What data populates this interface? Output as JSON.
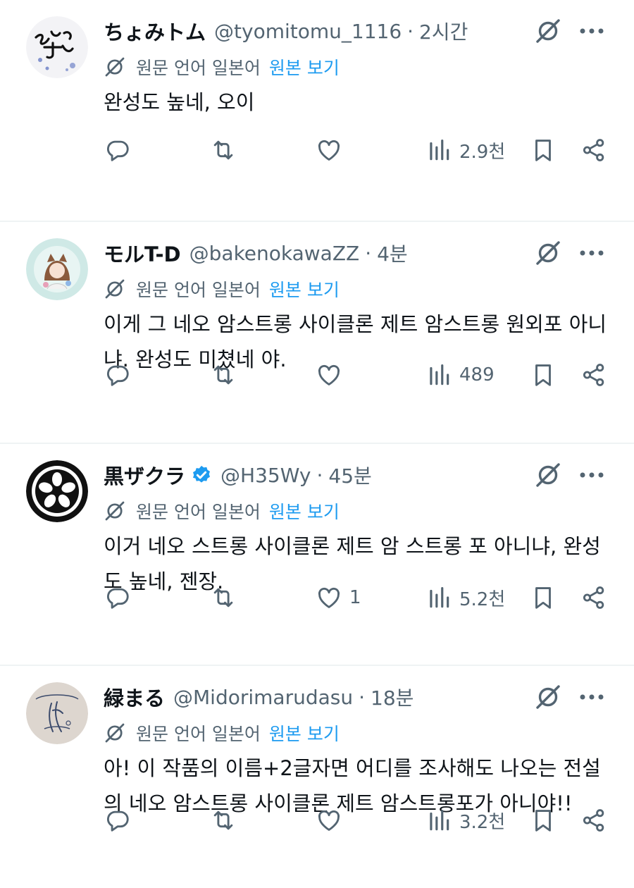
{
  "translate": {
    "label": "원문 언어 일본어",
    "link": "원본 보기"
  },
  "colors": {
    "text": "#0f1419",
    "secondary": "#536471",
    "link": "#1d9bf0",
    "verified": "#1d9bf0",
    "divider": "#eff3f4"
  },
  "icons": {
    "reply": "reply-icon",
    "retweet": "retweet-icon",
    "like": "heart-icon",
    "views": "views-icon",
    "bookmark": "bookmark-icon",
    "share": "share-icon",
    "grok": "grok-icon",
    "more": "more-icon",
    "translate": "translate-icon"
  },
  "tweets": [
    {
      "name": "ちょみトム",
      "handle": "@tyomitomu_1116",
      "sep": "·",
      "time": "2시간",
      "verified": false,
      "body": "완성도 높네, 오이",
      "likes": "",
      "views": "2.9천",
      "avatar": "avatar-text"
    },
    {
      "name": "モルT-D",
      "handle": "@bakenokawaZZ",
      "sep": "·",
      "time": "4분",
      "verified": false,
      "body": "이게 그 네오 암스트롱 사이클론 제트 암스트롱 원외포 아니냐. 완성도 미쳤네 야.",
      "likes": "",
      "views": "489",
      "avatar": "avatar-character"
    },
    {
      "name": "黒ザクラ",
      "handle": "@H35Wy",
      "sep": "·",
      "time": "45분",
      "verified": true,
      "body": "이거 네오 스트롱 사이클론 제트 암 스트롱 포 아니냐, 완성도 높네, 젠장.",
      "likes": "1",
      "views": "5.2천",
      "avatar": "avatar-crest"
    },
    {
      "name": "緑まる",
      "handle": "@Midorimarudasu",
      "sep": "·",
      "time": "18분",
      "verified": false,
      "body": "아! 이 작품의 이름+2글자면 어디를 조사해도 나오는 전설의 네오 암스트롱 사이클론 제트 암스트롱포가 아니야!!",
      "likes": "",
      "views": "3.2천",
      "avatar": "avatar-sketch"
    }
  ]
}
